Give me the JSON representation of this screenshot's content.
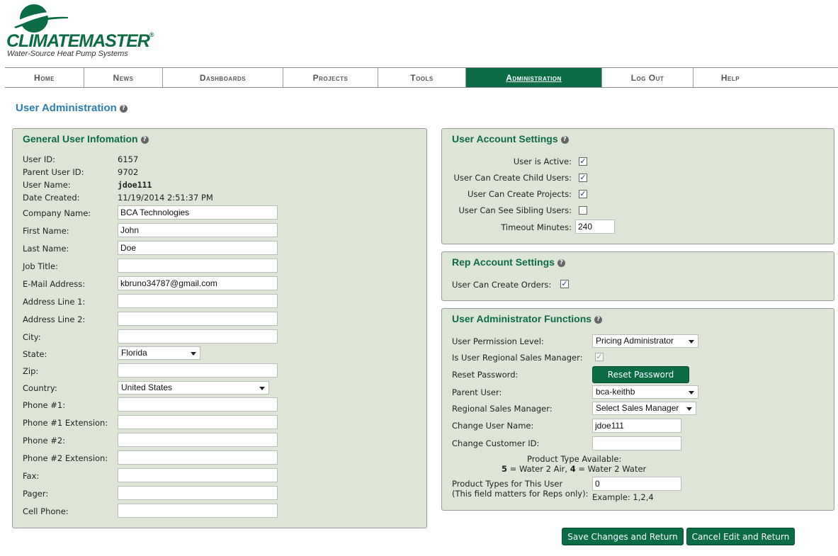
{
  "brand": {
    "name": "CLIMATEMASTER",
    "reg": "®",
    "tagline": "Water-Source Heat Pump Systems"
  },
  "nav": [
    "Home",
    "News",
    "Dashboards",
    "Projects",
    "Tools",
    "Administration",
    "Log Out",
    "Help"
  ],
  "page_title": "User Administration",
  "general": {
    "title": "General User Infomation",
    "fields": {
      "user_id": {
        "label": "User ID:",
        "value": "6157"
      },
      "parent_user_id": {
        "label": "Parent User ID:",
        "value": "9702"
      },
      "user_name": {
        "label": "User Name:",
        "value": "jdoe111"
      },
      "date_created": {
        "label": "Date Created:",
        "value": "11/19/2014 2:51:37 PM"
      },
      "company": {
        "label": "Company Name:",
        "value": "BCA Technologies"
      },
      "first": {
        "label": "First Name:",
        "value": "John"
      },
      "last": {
        "label": "Last Name:",
        "value": "Doe"
      },
      "job": {
        "label": "Job Title:",
        "value": ""
      },
      "email": {
        "label": "E-Mail Address:",
        "value": "kbruno34787@gmail.com"
      },
      "addr1": {
        "label": "Address Line 1:",
        "value": ""
      },
      "addr2": {
        "label": "Address Line 2:",
        "value": ""
      },
      "city": {
        "label": "City:",
        "value": ""
      },
      "state": {
        "label": "State:",
        "value": "Florida"
      },
      "zip": {
        "label": "Zip:",
        "value": ""
      },
      "country": {
        "label": "Country:",
        "value": "United States"
      },
      "phone1": {
        "label": "Phone #1:",
        "value": ""
      },
      "phone1ext": {
        "label": "Phone #1 Extension:",
        "value": ""
      },
      "phone2": {
        "label": "Phone #2:",
        "value": ""
      },
      "phone2ext": {
        "label": "Phone #2 Extension:",
        "value": ""
      },
      "fax": {
        "label": "Fax:",
        "value": ""
      },
      "pager": {
        "label": "Pager:",
        "value": ""
      },
      "cell": {
        "label": "Cell Phone:",
        "value": ""
      }
    }
  },
  "account": {
    "title": "User Account Settings",
    "active": {
      "label": "User is Active:",
      "checked": true
    },
    "child": {
      "label": "User Can Create Child Users:",
      "checked": true
    },
    "projects": {
      "label": "User Can Create Projects:",
      "checked": true
    },
    "sibling": {
      "label": "User Can See Sibling Users:",
      "checked": false
    },
    "timeout": {
      "label": "Timeout Minutes:",
      "value": "240"
    }
  },
  "rep": {
    "title": "Rep Account Settings",
    "orders": {
      "label": "User Can Create Orders:",
      "checked": true
    }
  },
  "admin": {
    "title": "User Administrator Functions",
    "permission": {
      "label": "User Permission Level:",
      "value": "Pricing Administrator"
    },
    "regional": {
      "label": "Is User Regional Sales Manager:",
      "checked": true
    },
    "reset": {
      "label": "Reset Password:",
      "button": "Reset Password"
    },
    "parent": {
      "label": "Parent User:",
      "value": "bca-keithb"
    },
    "rsm": {
      "label": "Regional Sales Manager:",
      "value": "Select Sales Manager"
    },
    "username": {
      "label": "Change User Name:",
      "value": "jdoe111"
    },
    "customer": {
      "label": "Change Customer ID:",
      "value": ""
    },
    "ptype_heading": "Product Type Available:",
    "ptype_k1": "5",
    "ptype_v1": " = Water 2 Air, ",
    "ptype_k2": "4",
    "ptype_v2": " = Water 2 Water",
    "ptypes_label1": "Product Types for This User",
    "ptypes_label2": "(This field matters for Reps only):",
    "ptypes_value": "0",
    "example": "Example: 1,2,4"
  },
  "buttons": {
    "save": "Save Changes and Return",
    "cancel": "Cancel Edit and Return"
  }
}
